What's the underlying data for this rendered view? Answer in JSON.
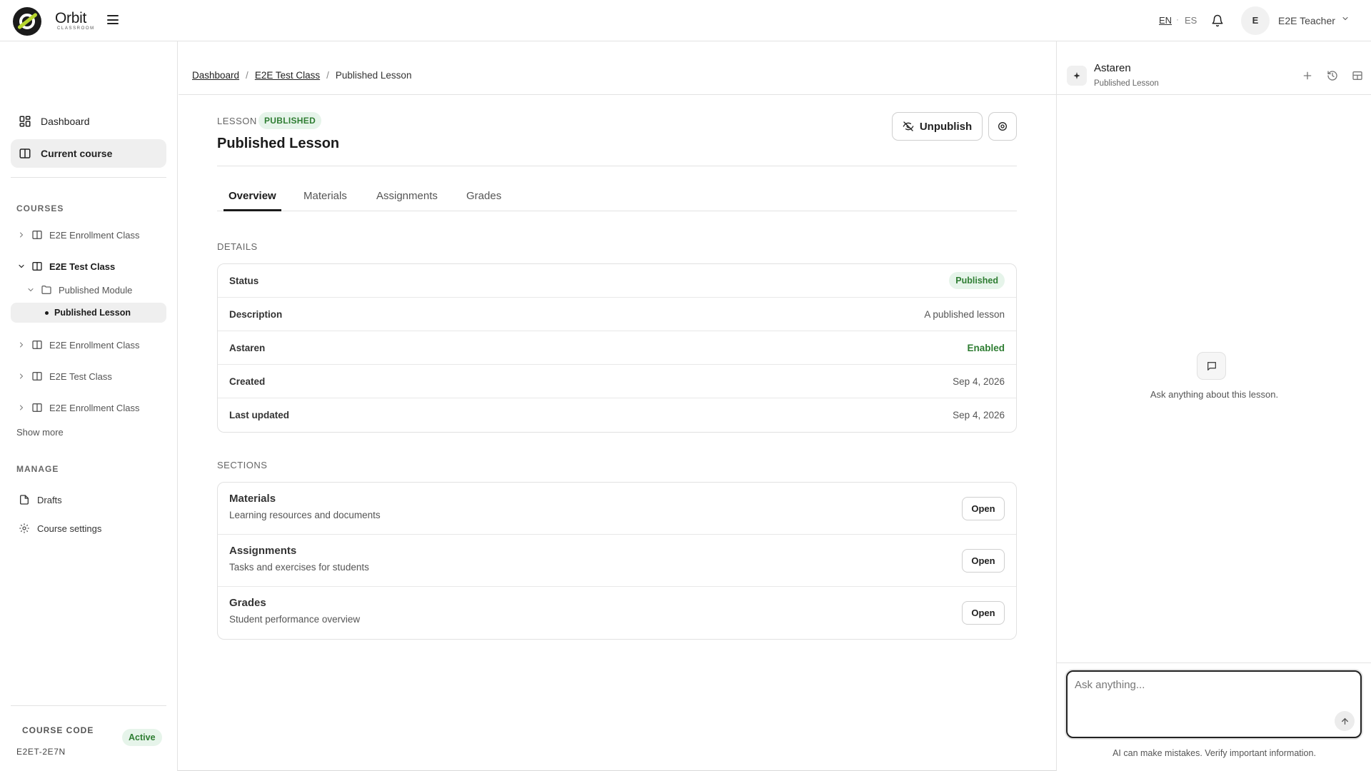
{
  "app": {
    "name": "Orbit",
    "subtitle": "CLASSROOM"
  },
  "header": {
    "languages": [
      "EN",
      "ES"
    ],
    "active_language": "EN",
    "user": {
      "initial": "E",
      "name": "E2E Teacher"
    }
  },
  "sidebar": {
    "nav": [
      {
        "label": "Dashboard",
        "icon": "dashboard-icon"
      },
      {
        "label": "Current course",
        "icon": "book-icon",
        "active": true
      }
    ],
    "courses_label": "COURSES",
    "courses": [
      {
        "label": "E2E Enrollment Class",
        "expanded": false
      },
      {
        "label": "E2E Test Class",
        "expanded": true
      },
      {
        "label": "E2E Enrollment Class",
        "expanded": false
      },
      {
        "label": "E2E Test Class",
        "expanded": false
      },
      {
        "label": "E2E Enrollment Class",
        "expanded": false
      }
    ],
    "module": {
      "label": "Published Module"
    },
    "lesson": {
      "label": "Published Lesson"
    },
    "show_more": "Show more",
    "manage_label": "MANAGE",
    "manage": [
      {
        "label": "Drafts",
        "icon": "file-icon"
      },
      {
        "label": "Course settings",
        "icon": "gear-icon"
      }
    ],
    "course_code_label": "COURSE CODE",
    "course_status": "Active",
    "course_code": "E2ET-2E7N"
  },
  "breadcrumb": [
    "Dashboard",
    "E2E Test Class",
    "Published Lesson"
  ],
  "lesson": {
    "kind_label": "LESSON",
    "status_badge": "PUBLISHED",
    "title": "Published Lesson",
    "unpublish_label": "Unpublish"
  },
  "tabs": [
    "Overview",
    "Materials",
    "Assignments",
    "Grades"
  ],
  "active_tab": "Overview",
  "details": {
    "label": "DETAILS",
    "rows": [
      {
        "key": "Status",
        "value": "Published"
      },
      {
        "key": "Description",
        "value": "A published lesson"
      },
      {
        "key": "Astaren",
        "value": "Enabled"
      },
      {
        "key": "Created",
        "value": "Sep 4, 2026"
      },
      {
        "key": "Last updated",
        "value": "Sep 4, 2026"
      }
    ]
  },
  "sections": {
    "label": "SECTIONS",
    "items": [
      {
        "title": "Materials",
        "desc": "Learning resources and documents",
        "action": "Open"
      },
      {
        "title": "Assignments",
        "desc": "Tasks and exercises for students",
        "action": "Open"
      },
      {
        "title": "Grades",
        "desc": "Student performance overview",
        "action": "Open"
      }
    ]
  },
  "assistant": {
    "title": "Astaren",
    "subtitle": "Published Lesson",
    "empty_text": "Ask anything about this lesson.",
    "input_placeholder": "Ask anything...",
    "disclaimer": "AI can make mistakes. Verify important information."
  },
  "colors": {
    "accent_green": "#2e7d32",
    "badge_green_bg": "#e6f4ea",
    "logo_green": "#b7d52e"
  }
}
